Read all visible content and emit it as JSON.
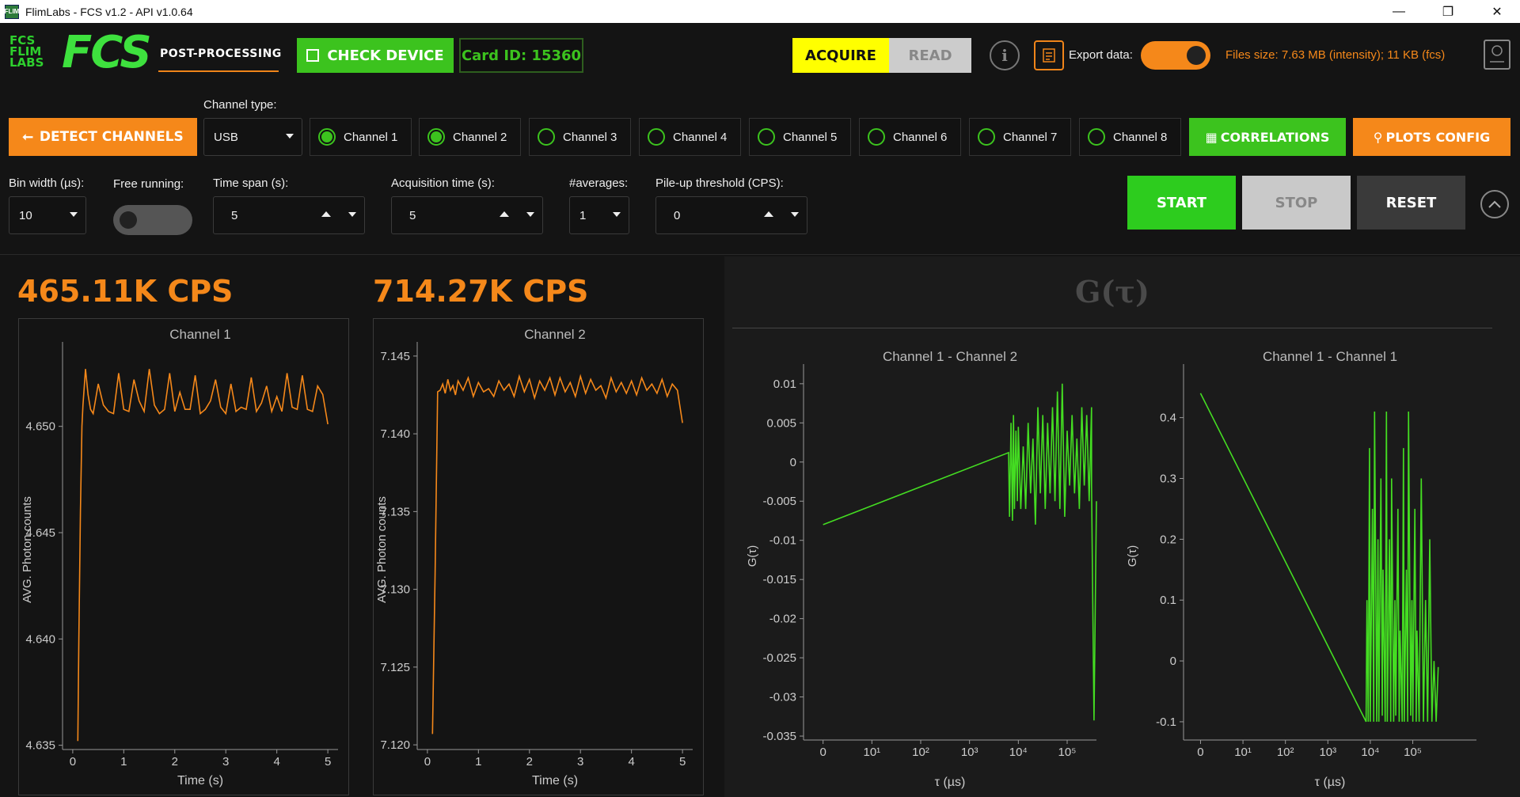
{
  "window": {
    "title": "FlimLabs - FCS v1.2 - API v1.0.64",
    "app_icon_text": "FLIM",
    "minimize": "—",
    "maximize": "❐",
    "close": "✕"
  },
  "header": {
    "logo_lines": [
      "FCS",
      "FLIM",
      "LABS"
    ],
    "logo_big": "FCS",
    "post_processing": "POST-PROCESSING",
    "check_device": "CHECK DEVICE",
    "card_id": "Card ID: 15360",
    "acquire": "ACQUIRE",
    "read": "READ",
    "info_icon": "i",
    "export_label": "Export data:",
    "export_on": true,
    "files_size": "Files size: 7.63 MB (intensity); 11 KB (fcs)"
  },
  "channels_bar": {
    "detect_channels": "DETECT CHANNELS",
    "channel_type_label": "Channel type:",
    "channel_type_value": "USB",
    "channels": [
      {
        "label": "Channel 1",
        "checked": true
      },
      {
        "label": "Channel 2",
        "checked": true
      },
      {
        "label": "Channel 3",
        "checked": false
      },
      {
        "label": "Channel 4",
        "checked": false
      },
      {
        "label": "Channel 5",
        "checked": false
      },
      {
        "label": "Channel 6",
        "checked": false
      },
      {
        "label": "Channel 7",
        "checked": false
      },
      {
        "label": "Channel 8",
        "checked": false
      }
    ],
    "correlations": "CORRELATIONS",
    "plots_config": "PLOTS CONFIG"
  },
  "params": {
    "bin_width_label": "Bin width (µs):",
    "bin_width_value": "10",
    "free_running_label": "Free running:",
    "free_running_on": false,
    "time_span_label": "Time span (s):",
    "time_span_value": "5",
    "acq_time_label": "Acquisition time (s):",
    "acq_time_value": "5",
    "averages_label": "#averages:",
    "averages_value": "1",
    "pileup_label": "Pile-up threshold (CPS):",
    "pileup_value": "0",
    "start": "START",
    "stop": "STOP",
    "reset": "RESET"
  },
  "cps": {
    "ch1": "465.11K CPS",
    "ch2": "714.27K CPS"
  },
  "right_title": "G(τ)",
  "colors": {
    "orange": "#f5881a",
    "green": "#3cc31e",
    "line_green": "#44dd22"
  },
  "chart_data": [
    {
      "type": "line",
      "title": "Channel 1",
      "xlabel": "Time (s)",
      "ylabel": "AVG. Photon counts",
      "xlim": [
        -0.2,
        5.2
      ],
      "ylim": [
        4.6348,
        4.6536
      ],
      "xticks": [
        "0",
        "1",
        "2",
        "3",
        "4",
        "5"
      ],
      "yticks": [
        "4.635",
        "4.640",
        "4.645",
        "4.650"
      ],
      "series": [
        {
          "x": [
            0.1,
            0.12,
            0.15,
            0.18,
            0.2,
            0.25,
            0.3,
            0.35,
            0.4,
            0.5,
            0.6,
            0.7,
            0.8,
            0.9,
            1.0,
            1.1,
            1.2,
            1.3,
            1.4,
            1.5,
            1.6,
            1.7,
            1.8,
            1.9,
            2.0,
            2.1,
            2.2,
            2.3,
            2.4,
            2.5,
            2.6,
            2.7,
            2.8,
            2.9,
            3.0,
            3.1,
            3.2,
            3.3,
            3.4,
            3.5,
            3.6,
            3.7,
            3.8,
            3.9,
            4.0,
            4.1,
            4.2,
            4.3,
            4.4,
            4.5,
            4.6,
            4.7,
            4.8,
            4.9,
            5.0
          ],
          "y": [
            4.6352,
            4.64,
            4.646,
            4.65,
            4.651,
            4.6527,
            4.6515,
            4.6508,
            4.6506,
            4.652,
            4.651,
            4.6507,
            4.6506,
            4.6525,
            4.6508,
            4.6507,
            4.6522,
            4.6512,
            4.6507,
            4.6527,
            4.651,
            4.6506,
            4.6508,
            4.6525,
            4.6507,
            4.6516,
            4.6508,
            4.6508,
            4.6524,
            4.6506,
            4.6508,
            4.6512,
            4.6522,
            4.6509,
            4.6506,
            4.652,
            4.6507,
            4.6509,
            4.6508,
            4.6523,
            4.6507,
            4.6511,
            4.6519,
            4.6507,
            4.6514,
            4.6507,
            4.6525,
            4.6509,
            4.6508,
            4.6524,
            4.6508,
            4.6507,
            4.6519,
            4.6515,
            4.6501
          ]
        }
      ]
    },
    {
      "type": "line",
      "title": "Channel 2",
      "xlabel": "Time (s)",
      "ylabel": "AVG. Photon counts",
      "xlim": [
        -0.2,
        5.2
      ],
      "ylim": [
        7.1197,
        7.1454
      ],
      "xticks": [
        "0",
        "1",
        "2",
        "3",
        "4",
        "5"
      ],
      "yticks": [
        "7.120",
        "7.125",
        "7.130",
        "7.135",
        "7.140",
        "7.145"
      ],
      "series": [
        {
          "x": [
            0.1,
            0.15,
            0.2,
            0.25,
            0.3,
            0.35,
            0.4,
            0.45,
            0.5,
            0.55,
            0.6,
            0.7,
            0.8,
            0.9,
            1.0,
            1.1,
            1.2,
            1.3,
            1.4,
            1.5,
            1.6,
            1.7,
            1.8,
            1.9,
            2.0,
            2.1,
            2.2,
            2.3,
            2.4,
            2.5,
            2.6,
            2.7,
            2.8,
            2.9,
            3.0,
            3.1,
            3.2,
            3.3,
            3.4,
            3.5,
            3.6,
            3.7,
            3.8,
            3.9,
            4.0,
            4.1,
            4.2,
            4.3,
            4.4,
            4.5,
            4.6,
            4.7,
            4.8,
            4.9,
            5.0
          ],
          "y": [
            7.1207,
            7.131,
            7.1427,
            7.1428,
            7.1432,
            7.1426,
            7.1435,
            7.1428,
            7.1431,
            7.1425,
            7.1434,
            7.1428,
            7.1436,
            7.1424,
            7.1433,
            7.1427,
            7.1429,
            7.1424,
            7.1434,
            7.1428,
            7.1432,
            7.1424,
            7.1437,
            7.1427,
            7.1435,
            7.1423,
            7.1434,
            7.1428,
            7.1436,
            7.1425,
            7.1436,
            7.1427,
            7.1433,
            7.1424,
            7.1437,
            7.1426,
            7.1435,
            7.1428,
            7.1431,
            7.1423,
            7.1436,
            7.1427,
            7.1433,
            7.1426,
            7.1434,
            7.1425,
            7.1436,
            7.1428,
            7.1432,
            7.1426,
            7.1435,
            7.1424,
            7.1432,
            7.1428,
            7.1407
          ]
        }
      ]
    },
    {
      "type": "line",
      "title": "Channel 1 - Channel 2",
      "xlabel": "τ (µs)",
      "ylabel": "G(τ)",
      "xlim": [
        -0.4,
        5.6
      ],
      "ylim": [
        -0.0355,
        0.0115
      ],
      "xticks": [
        "0",
        "10¹",
        "10²",
        "10³",
        "10⁴",
        "10⁵"
      ],
      "yticks": [
        "0.01",
        "0.005",
        "0",
        "-0.005",
        "-0.01",
        "-0.015",
        "-0.02",
        "-0.025",
        "-0.03",
        "-0.035"
      ],
      "series": [
        {
          "x": [
            0,
            3.8,
            3.82,
            3.85,
            3.88,
            3.9,
            3.92,
            3.95,
            3.98,
            4.0,
            4.05,
            4.1,
            4.15,
            4.2,
            4.25,
            4.3,
            4.35,
            4.4,
            4.45,
            4.5,
            4.55,
            4.6,
            4.65,
            4.7,
            4.75,
            4.8,
            4.85,
            4.9,
            4.95,
            5.0,
            5.05,
            5.1,
            5.15,
            5.2,
            5.25,
            5.3,
            5.35,
            5.4,
            5.45,
            5.5,
            5.5,
            5.55,
            5.6
          ],
          "y": [
            -0.008,
            0.0012,
            -0.007,
            0.005,
            -0.0075,
            0.006,
            -0.006,
            0.004,
            -0.005,
            0.0045,
            -0.006,
            0.002,
            -0.006,
            0.005,
            -0.004,
            0.003,
            -0.008,
            0.007,
            -0.004,
            0.006,
            -0.006,
            0.005,
            -0.004,
            0.007,
            -0.005,
            0.009,
            -0.006,
            0.01,
            -0.007,
            0.004,
            -0.003,
            0.006,
            -0.004,
            0.003,
            -0.006,
            0.007,
            -0.003,
            0.006,
            -0.005,
            0.007,
            -0.003,
            -0.033,
            -0.005
          ]
        }
      ]
    },
    {
      "type": "line",
      "title": "Channel 1 - Channel 1",
      "xlabel": "τ (µs)",
      "ylabel": "G(τ)",
      "xlim": [
        -0.4,
        6.5
      ],
      "ylim": [
        -0.13,
        0.475
      ],
      "xticks": [
        "0",
        "10¹",
        "10²",
        "10³",
        "10⁴",
        "10⁵"
      ],
      "yticks": [
        "0.4",
        "0.3",
        "0.2",
        "0.1",
        "0",
        "-0.1"
      ],
      "series": [
        {
          "x": [
            0,
            3.9,
            3.92,
            3.95,
            3.98,
            4.0,
            4.05,
            4.08,
            4.1,
            4.15,
            4.18,
            4.2,
            4.25,
            4.28,
            4.3,
            4.35,
            4.38,
            4.4,
            4.45,
            4.48,
            4.5,
            4.55,
            4.58,
            4.6,
            4.65,
            4.68,
            4.7,
            4.75,
            4.78,
            4.8,
            4.85,
            4.88,
            4.9,
            4.95,
            4.98,
            5.0,
            5.05,
            5.08,
            5.1,
            5.15,
            5.2,
            5.25,
            5.3,
            5.35,
            5.4,
            5.45,
            5.5,
            5.55,
            5.6
          ],
          "y": [
            0.44,
            -0.1,
            0.1,
            -0.1,
            0.35,
            -0.1,
            0.25,
            -0.1,
            0.41,
            -0.1,
            0.2,
            -0.1,
            0.3,
            -0.09,
            0.15,
            -0.1,
            0.41,
            -0.1,
            0.2,
            -0.1,
            0.3,
            -0.1,
            0.1,
            -0.09,
            0.25,
            -0.1,
            0.05,
            -0.1,
            0.35,
            -0.1,
            0.15,
            -0.1,
            0.41,
            -0.09,
            0.1,
            -0.1,
            0.25,
            -0.1,
            0.05,
            -0.1,
            0.3,
            -0.1,
            0.1,
            -0.1,
            0.2,
            -0.1,
            0.0,
            -0.1,
            -0.01
          ]
        }
      ]
    }
  ]
}
